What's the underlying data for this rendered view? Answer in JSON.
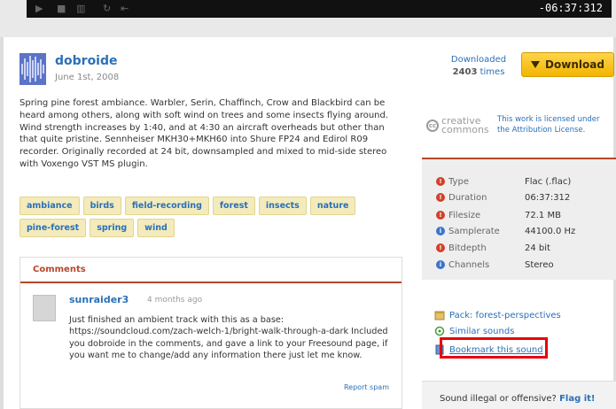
{
  "player": {
    "time": "-06:37:312"
  },
  "header": {
    "username": "dobroide",
    "date": "June 1st, 2008",
    "downloaded_label": "Downloaded",
    "downloaded_count": "2403",
    "downloaded_suffix": "times",
    "download_button": "Download"
  },
  "description": "Spring pine forest ambiance. Warbler, Serin, Chaffinch, Crow and Blackbird can be heard among others, along with soft wind on trees and some insects flying around. Wind strength increases by 1:40, and at 4:30 an aircraft overheads but other than that quite pristine. Sennheiser MKH30+MKH60 into Shure FP24 and Edirol R09 recorder. Originally recorded at 24 bit, downsampled and mixed to mid-side stereo with Voxengo VST MS plugin.",
  "tags": [
    "ambiance",
    "birds",
    "field-recording",
    "forest",
    "insects",
    "nature",
    "pine-forest",
    "spring",
    "wind"
  ],
  "comments": {
    "title": "Comments",
    "user": "sunraider3",
    "time": "4 months ago",
    "text": "Just finished an ambient track with this as a base: https://soundcloud.com/zach-welch-1/bright-walk-through-a-dark Included you dobroide in the comments, and gave a link to your Freesound page, if you want me to change/add any information there just let me know.",
    "report": "Report spam"
  },
  "license": {
    "cc_top": "creative",
    "cc_bottom": "commons",
    "text": "This work is licensed under the Attribution License."
  },
  "info": {
    "type_label": "Type",
    "type_value": "Flac (.flac)",
    "duration_label": "Duration",
    "duration_value": "06:37:312",
    "filesize_label": "Filesize",
    "filesize_value": "72.1 MB",
    "samplerate_label": "Samplerate",
    "samplerate_value": "44100.0 Hz",
    "bitdepth_label": "Bitdepth",
    "bitdepth_value": "24 bit",
    "channels_label": "Channels",
    "channels_value": "Stereo"
  },
  "links": {
    "pack": "Pack: forest-perspectives",
    "similar": "Similar sounds",
    "bookmark": "Bookmark this sound"
  },
  "illegal": {
    "text": "Sound illegal or offensive?",
    "flag": "Flag it!"
  },
  "colors": {
    "link": "#2a70b8",
    "accent": "#b7472a",
    "download": "#f2b500",
    "highlight": "#e8000b"
  }
}
